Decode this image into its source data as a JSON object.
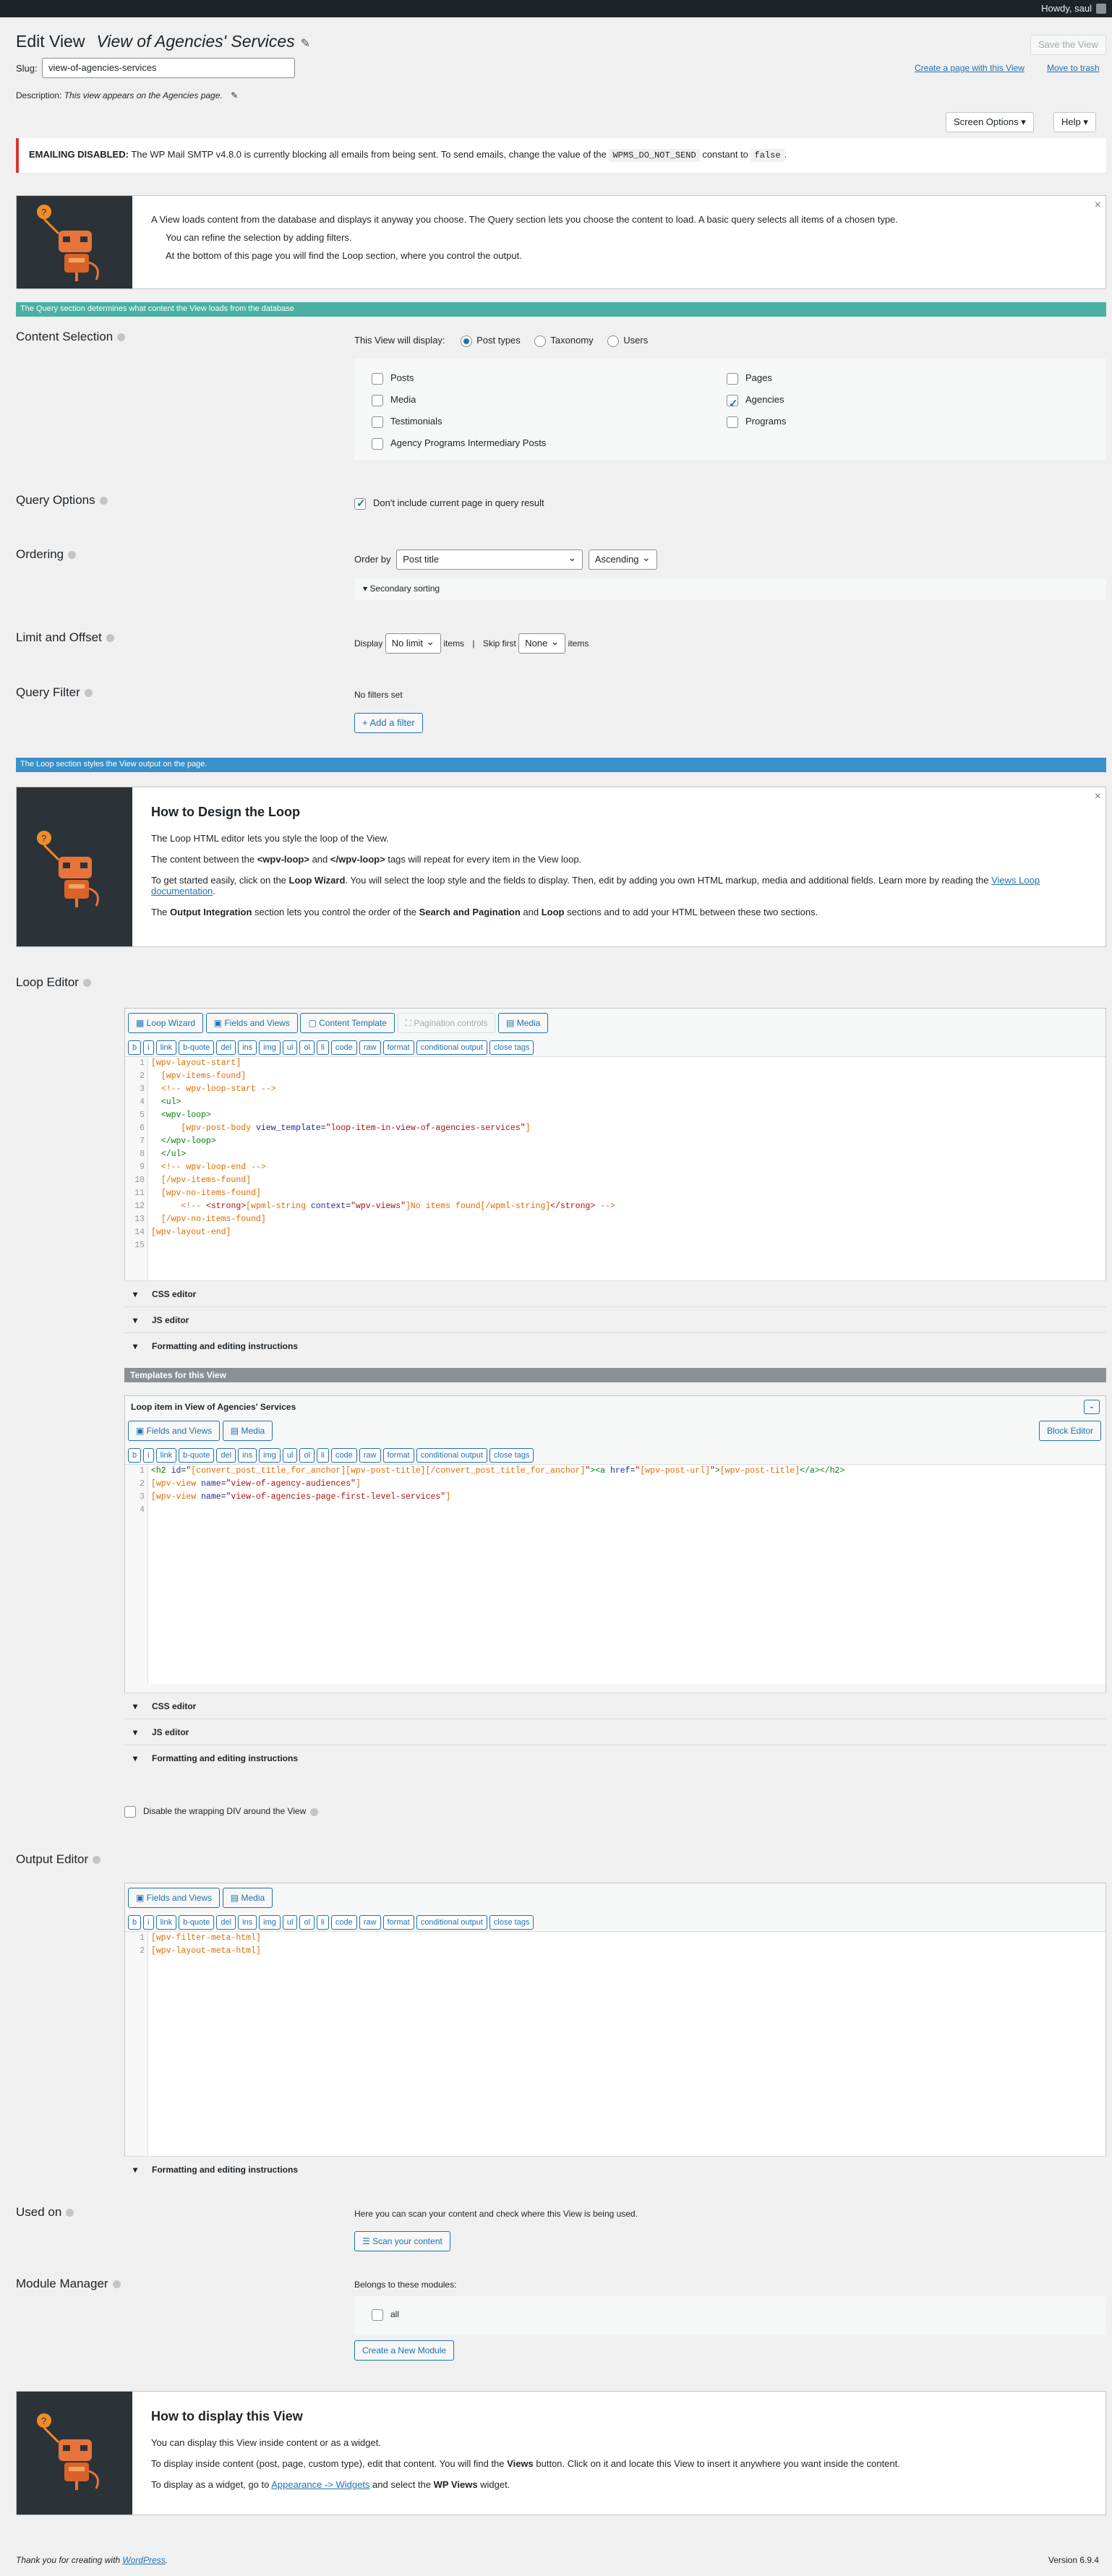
{
  "adminbar": {
    "howdy": "Howdy, saul"
  },
  "header": {
    "edit_view": "Edit View",
    "view_title": "View of Agencies' Services",
    "save": "Save the View",
    "create_page": "Create a page with this View",
    "trash": "Move to trash",
    "slug_label": "Slug:",
    "slug_value": "view-of-agencies-services",
    "desc_label": "Description:",
    "desc_value": "This view appears on the Agencies page."
  },
  "screen": {
    "options": "Screen Options ▾",
    "help": "Help ▾"
  },
  "notice": {
    "bold": "EMAILING DISABLED:",
    "text1": " The WP Mail SMTP v4.8.0 is currently blocking all emails from being sent. To send emails, change the value of the ",
    "code1": "WPMS_DO_NOT_SEND",
    "text2": " constant to ",
    "code2": "false",
    "text3": "."
  },
  "intro": {
    "p1": "A View loads content from the database and displays it anyway you choose. The Query section lets you choose the content to load. A basic query selects all items of a chosen type.",
    "li1": "You can refine the selection by adding filters.",
    "li2": "At the bottom of this page you will find the Loop section, where you control the output."
  },
  "query_bar": "The Query section determines what content the View loads from the database",
  "content_selection": {
    "title": "Content Selection",
    "display_label": "This View will display:",
    "radios": [
      "Post types",
      "Taxonomy",
      "Users"
    ],
    "left": [
      "Posts",
      "Media",
      "Testimonials",
      "Agency Programs Intermediary Posts"
    ],
    "right": [
      "Pages",
      "Agencies",
      "Programs"
    ]
  },
  "query_options": {
    "title": "Query Options",
    "checkbox": "Don't include current page in query result"
  },
  "ordering": {
    "title": "Ordering",
    "label": "Order by",
    "field": "Post title",
    "dir": "Ascending",
    "secondary": "Secondary sorting"
  },
  "limit": {
    "title": "Limit and Offset",
    "display": "Display",
    "no_limit": "No limit",
    "items": "items",
    "sep": "|",
    "skip": "Skip first",
    "none": "None",
    "items2": "items"
  },
  "filter": {
    "title": "Query Filter",
    "none": "No filters set",
    "add": "+ Add a filter"
  },
  "loop_bar": "The Loop section styles the View output on the page.",
  "design": {
    "title": "How to Design the Loop",
    "p1": "The Loop HTML editor lets you style the loop of the View.",
    "p2a": "The content between the ",
    "p2b": "<wpv-loop>",
    "p2c": " and ",
    "p2d": "</wpv-loop>",
    "p2e": " tags will repeat for every item in the View loop.",
    "p3a": "To get started easily, click on the ",
    "p3b": "Loop Wizard",
    "p3c": ". You will select the loop style and the fields to display. Then, edit by adding you own HTML markup, media and additional fields. Learn more by reading the ",
    "p3d": "Views Loop documentation",
    "p3e": ".",
    "p4a": "The ",
    "p4b": "Output Integration",
    "p4c": " section lets you control the order of the ",
    "p4d": "Search and Pagination",
    "p4e": " and ",
    "p4f": "Loop",
    "p4g": " sections and to add your HTML between these two sections."
  },
  "loop_editor": {
    "title": "Loop Editor",
    "tabs": [
      "Loop Wizard",
      "Fields and Views",
      "Content Template",
      "Pagination controls",
      "Media"
    ]
  },
  "qtags": [
    "b",
    "i",
    "link",
    "b-quote",
    "del",
    "ins",
    "img",
    "ul",
    "ol",
    "li",
    "code",
    "raw",
    "format",
    "conditional output",
    "close tags"
  ],
  "accordions": {
    "css": "CSS editor",
    "js": "JS editor",
    "fmt": "Formatting and editing instructions"
  },
  "templates": {
    "header": "Templates for this View",
    "item": "Loop item in View of Agencies' Services",
    "collapse": "-",
    "fields": "Fields and Views",
    "media": "Media",
    "block": "Block Editor"
  },
  "wrap": {
    "label": "Disable the wrapping DIV around the View"
  },
  "output": {
    "title": "Output Editor",
    "fields": "Fields and Views",
    "media": "Media"
  },
  "used_on": {
    "title": "Used on",
    "text": "Here you can scan your content and check where this View is being used.",
    "btn": "Scan your content"
  },
  "module": {
    "title": "Module Manager",
    "label": "Belongs to these modules:",
    "all": "all",
    "btn": "Create a New Module"
  },
  "display": {
    "title": "How to display this View",
    "p1": "You can display this View inside content or as a widget.",
    "p2a": "To display inside content (post, page, custom type), edit that content. You will find the ",
    "p2b": "Views",
    "p2c": " button. Click on it and locate this View to insert it anywhere you want inside the content.",
    "p3a": "To display as a widget, go to ",
    "p3b": "Appearance -> Widgets",
    "p3c": " and select the ",
    "p3d": "WP Views",
    "p3e": " widget."
  },
  "footer": {
    "thanks": "Thank you for creating with ",
    "wp": "WordPress",
    "dot": ".",
    "version": "Version 6.9.4"
  },
  "colors": {
    "query_bar": "#4ab0a4",
    "loop_bar": "#3a90c9",
    "accent": "#2271b1"
  }
}
